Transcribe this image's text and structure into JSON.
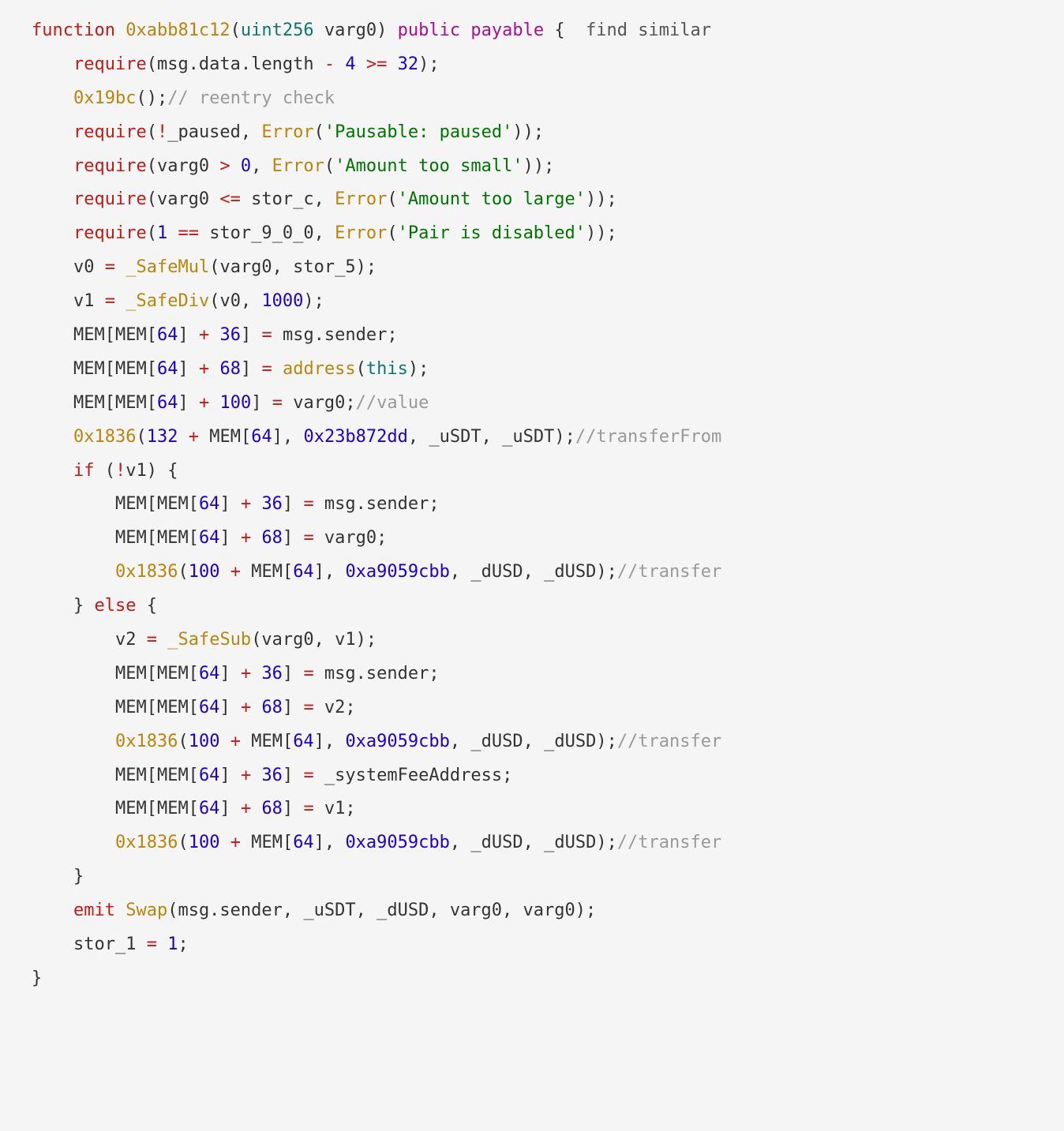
{
  "line1": {
    "function": "function",
    "name": "0xabb81c12",
    "lparen": "(",
    "type": "uint256",
    "arg": " varg0",
    "rparen": ") ",
    "public": "public",
    "payable": "payable",
    "brace": " {  ",
    "find": "find similar"
  },
  "line2": {
    "indent": "    ",
    "require": "require",
    "pre": "(msg.data.length ",
    "op1": "-",
    "mid": " ",
    "four": "4",
    "gte": " >= ",
    "num": "32",
    "post": ");"
  },
  "line3": {
    "indent": "    ",
    "fn": "0x19bc",
    "call": "();",
    "comment": "// reentry check"
  },
  "line4": {
    "indent": "    ",
    "require": "require",
    "pre": "(",
    "bang": "!",
    "paused": "_paused, ",
    "error": "Error",
    "open": "(",
    "str": "'Pausable: paused'",
    "close": "));"
  },
  "line5": {
    "indent": "    ",
    "require": "require",
    "pre": "(varg0 ",
    "op": ">",
    "sp": " ",
    "zero": "0",
    "comma": ", ",
    "error": "Error",
    "open": "(",
    "str": "'Amount too small'",
    "close": "));"
  },
  "line6": {
    "indent": "    ",
    "require": "require",
    "pre": "(varg0 ",
    "op": "<=",
    "post": " stor_c, ",
    "error": "Error",
    "open": "(",
    "str": "'Amount too large'",
    "close": "));"
  },
  "line7": {
    "indent": "    ",
    "require": "require",
    "open": "(",
    "one": "1",
    "eq": " == ",
    "stor": "stor_9_0_0, ",
    "error": "Error",
    "open2": "(",
    "str": "'Pair is disabled'",
    "close": "));"
  },
  "line8": {
    "indent": "    ",
    "pre": "v0 ",
    "eq": "=",
    "sp": " ",
    "fn": "_SafeMul",
    "args": "(varg0, stor_5);"
  },
  "line9": {
    "indent": "    ",
    "pre": "v1 ",
    "eq": "=",
    "sp": " ",
    "fn": "_SafeDiv",
    "open": "(v0, ",
    "num": "1000",
    "close": ");"
  },
  "line10": {
    "indent": "    ",
    "pre": "MEM[MEM[",
    "n64": "64",
    "mid": "] ",
    "plus": "+",
    "sp": " ",
    "n36": "36",
    "post": "] ",
    "eq": "=",
    "val": " msg.sender;"
  },
  "line11": {
    "indent": "    ",
    "pre": "MEM[MEM[",
    "n64": "64",
    "mid": "] ",
    "plus": "+",
    "sp": " ",
    "n68": "68",
    "post": "] ",
    "eq": "=",
    "sp2": " ",
    "addr": "address",
    "open": "(",
    "this": "this",
    "close": ");"
  },
  "line12": {
    "indent": "    ",
    "pre": "MEM[MEM[",
    "n64": "64",
    "mid": "] ",
    "plus": "+",
    "sp": " ",
    "n100": "100",
    "post": "] ",
    "eq": "=",
    "val": " varg0;",
    "comment": "//value"
  },
  "line13": {
    "indent": "    ",
    "fn": "0x1836",
    "open": "(",
    "n132": "132",
    "plus": " + ",
    "mem": "MEM[",
    "n64": "64",
    "close1": "], ",
    "sel": "0x23b872dd",
    "args": ", _uSDT, _uSDT);",
    "comment": "//transferFrom"
  },
  "line14": {
    "indent": "    ",
    "if": "if",
    "pre": " (",
    "bang": "!",
    "post": "v1) {"
  },
  "line15": {
    "indent": "        ",
    "pre": "MEM[MEM[",
    "n64": "64",
    "mid": "] ",
    "plus": "+",
    "sp": " ",
    "n36": "36",
    "post": "] ",
    "eq": "=",
    "val": " msg.sender;"
  },
  "line16": {
    "indent": "        ",
    "pre": "MEM[MEM[",
    "n64": "64",
    "mid": "] ",
    "plus": "+",
    "sp": " ",
    "n68": "68",
    "post": "] ",
    "eq": "=",
    "val": " varg0;"
  },
  "line17": {
    "indent": "        ",
    "fn": "0x1836",
    "open": "(",
    "n100": "100",
    "plus": " + ",
    "mem": "MEM[",
    "n64": "64",
    "close1": "], ",
    "sel": "0xa9059cbb",
    "args": ", _dUSD, _dUSD);",
    "comment": "//transfer"
  },
  "line18": {
    "indent": "    ",
    "close": "} ",
    "else": "else",
    "open": " {"
  },
  "line19": {
    "indent": "        ",
    "pre": "v2 ",
    "eq": "=",
    "sp": " ",
    "fn": "_SafeSub",
    "args": "(varg0, v1);"
  },
  "line20": {
    "indent": "        ",
    "pre": "MEM[MEM[",
    "n64": "64",
    "mid": "] ",
    "plus": "+",
    "sp": " ",
    "n36": "36",
    "post": "] ",
    "eq": "=",
    "val": " msg.sender;"
  },
  "line21": {
    "indent": "        ",
    "pre": "MEM[MEM[",
    "n64": "64",
    "mid": "] ",
    "plus": "+",
    "sp": " ",
    "n68": "68",
    "post": "] ",
    "eq": "=",
    "val": " v2;"
  },
  "line22": {
    "indent": "        ",
    "fn": "0x1836",
    "open": "(",
    "n100": "100",
    "plus": " + ",
    "mem": "MEM[",
    "n64": "64",
    "close1": "], ",
    "sel": "0xa9059cbb",
    "args": ", _dUSD, _dUSD);",
    "comment": "//transfer"
  },
  "line23": {
    "indent": "        ",
    "pre": "MEM[MEM[",
    "n64": "64",
    "mid": "] ",
    "plus": "+",
    "sp": " ",
    "n36": "36",
    "post": "] ",
    "eq": "=",
    "val": " _systemFeeAddress;"
  },
  "line24": {
    "indent": "        ",
    "pre": "MEM[MEM[",
    "n64": "64",
    "mid": "] ",
    "plus": "+",
    "sp": " ",
    "n68": "68",
    "post": "] ",
    "eq": "=",
    "val": " v1;"
  },
  "line25": {
    "indent": "        ",
    "fn": "0x1836",
    "open": "(",
    "n100": "100",
    "plus": " + ",
    "mem": "MEM[",
    "n64": "64",
    "close1": "], ",
    "sel": "0xa9059cbb",
    "args": ", _dUSD, _dUSD);",
    "comment": "//transfer"
  },
  "line26": {
    "indent": "    ",
    "close": "}"
  },
  "line27": {
    "indent": "    ",
    "emit": "emit",
    "sp": " ",
    "name": "Swap",
    "args": "(msg.sender, _uSDT, _dUSD, varg0, varg0);"
  },
  "line28": {
    "indent": "    ",
    "pre": "stor_1 ",
    "eq": "=",
    "sp": " ",
    "one": "1",
    "semi": ";"
  },
  "line29": {
    "close": "}"
  }
}
